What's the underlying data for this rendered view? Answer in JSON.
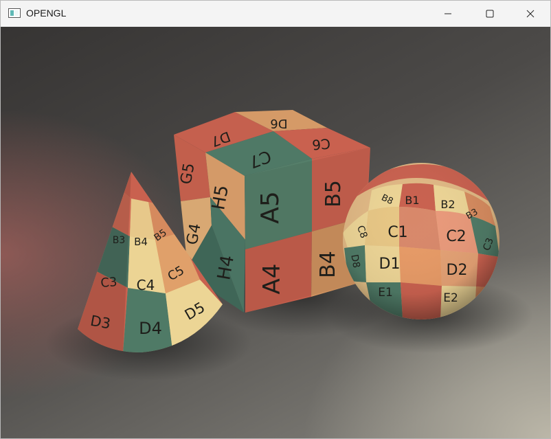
{
  "window": {
    "title": "OPENGL"
  },
  "colors": {
    "red": "#c96050",
    "green": "#4f7a66",
    "yellow": "#e9d290",
    "orange": "#d89a68",
    "titlebar": "#f4f4f4"
  },
  "icons": {
    "app": "opengl-app-icon",
    "minimize": "minimize-icon",
    "maximize": "maximize-icon",
    "close": "close-icon"
  },
  "scene": {
    "cube": {
      "front": [
        "A5",
        "B5",
        "A4",
        "B4"
      ],
      "left": [
        "G5",
        "H5",
        "G4",
        "H4"
      ],
      "top": [
        "D7",
        "D6",
        "C7",
        "C6"
      ]
    },
    "cone": {
      "labels": [
        "D3",
        "D4",
        "D5",
        "C3",
        "C4",
        "C5",
        "B3",
        "B4",
        "B5"
      ]
    },
    "sphere": {
      "labels": [
        "B8",
        "B1",
        "B2",
        "B3",
        "C8",
        "C1",
        "C2",
        "C3",
        "D8",
        "D1",
        "D2",
        "E1",
        "E2"
      ]
    }
  }
}
